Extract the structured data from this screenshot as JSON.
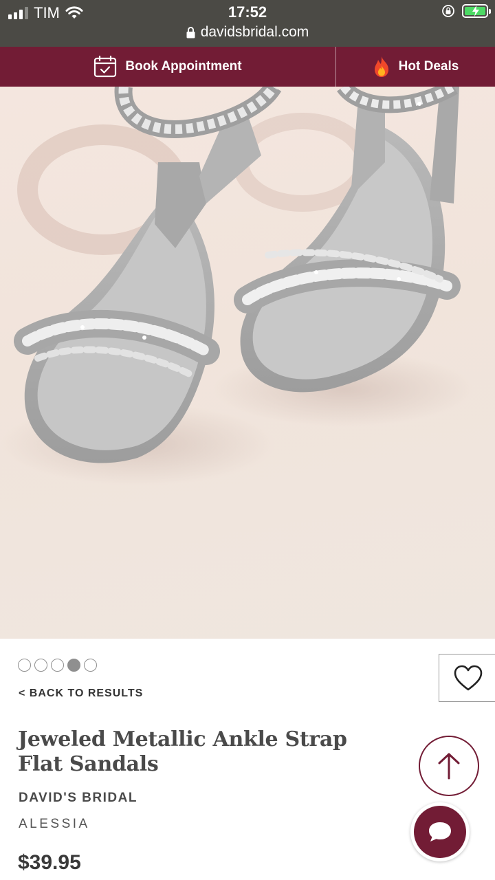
{
  "status_bar": {
    "carrier": "TIM",
    "time": "17:52",
    "url": "davidsbridal.com"
  },
  "nav": {
    "book_label": "Book Appointment",
    "hot_label": "Hot Deals"
  },
  "gallery": {
    "dot_count": 5,
    "active_index": 3
  },
  "product": {
    "back_label": "< BACK TO RESULTS",
    "title": "Jeweled Metallic Ankle Strap Flat Sandals",
    "brand": "DAVID'S BRIDAL",
    "style": "ALESSIA",
    "price": "$39.95"
  },
  "colors": {
    "brand": "#721c35",
    "status_bar": "#4b4a45",
    "battery": "#4cd964"
  },
  "icons": {
    "book": "calendar-check-icon",
    "hot": "flame-icon",
    "favorite": "heart-icon",
    "scroll_top": "arrow-up-icon",
    "chat": "chat-bubble-icon"
  }
}
